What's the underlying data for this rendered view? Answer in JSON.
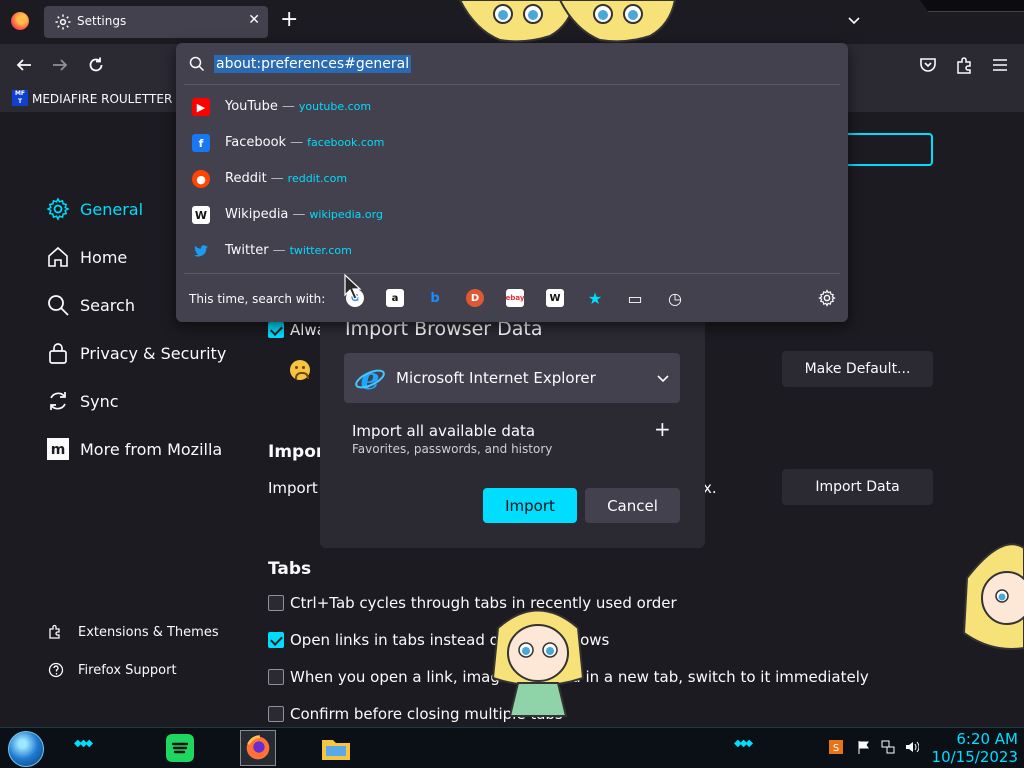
{
  "tab": {
    "title": "Settings",
    "close_glyph": "✕",
    "new_tab_glyph": "+"
  },
  "bookmarks": {
    "items": [
      {
        "label": "MEDIAFIRE ROULETTER",
        "icon_text": "MF T"
      }
    ]
  },
  "sidebar": {
    "categories": [
      {
        "label": "General",
        "icon": "gear-icon",
        "active": true
      },
      {
        "label": "Home",
        "icon": "home-icon"
      },
      {
        "label": "Search",
        "icon": "search-icon"
      },
      {
        "label": "Privacy & Security",
        "icon": "lock-icon"
      },
      {
        "label": "Sync",
        "icon": "sync-icon"
      },
      {
        "label": "More from Mozilla",
        "icon": "mozilla-icon"
      }
    ],
    "footer": [
      {
        "label": "Extensions & Themes",
        "icon": "puzzle-icon"
      },
      {
        "label": "Firefox Support",
        "icon": "help-icon"
      }
    ]
  },
  "general": {
    "always_check_partial": "Alwa",
    "make_default_label": "Make Default...",
    "import_heading_partial": "Import",
    "import_text_partial": "Import",
    "import_text_tail": "x.",
    "import_data_label": "Import Data",
    "tabs_heading": "Tabs",
    "tab_options": [
      {
        "label": "Ctrl+Tab cycles through tabs in recently used order",
        "checked": false
      },
      {
        "label": "Open links in tabs instead of new windows",
        "checked": true
      },
      {
        "label": "When you open a link, image or media in a new tab, switch to it immediately",
        "checked": false
      },
      {
        "label": "Confirm before closing multiple tabs",
        "checked": false
      }
    ]
  },
  "import_dialog": {
    "title": "Import Browser Data",
    "browser": "Microsoft Internet Explorer",
    "option_title": "Import all available data",
    "option_subtitle": "Favorites, passwords, and history",
    "plus_glyph": "+",
    "import_button": "Import",
    "cancel_button": "Cancel"
  },
  "url_panel": {
    "url": "about:preferences#general",
    "suggestions": [
      {
        "name": "YouTube",
        "site": "youtube.com",
        "icon_bg": "#ff0000",
        "icon_text": "▶"
      },
      {
        "name": "Facebook",
        "site": "facebook.com",
        "icon_bg": "#1877f2",
        "icon_text": "f"
      },
      {
        "name": "Reddit",
        "site": "reddit.com",
        "icon_bg": "#ff4500",
        "icon_text": "●"
      },
      {
        "name": "Wikipedia",
        "site": "wikipedia.org",
        "icon_bg": "#ffffff",
        "icon_text": "W"
      },
      {
        "name": "Twitter",
        "site": "twitter.com",
        "icon_bg": "#42414d",
        "icon_text": "🐦"
      }
    ],
    "separator": "—",
    "search_with_label": "This time, search with:",
    "engines": [
      {
        "name": "google-icon",
        "text": "G",
        "bg": "#ffffff",
        "fg": "#4285f4"
      },
      {
        "name": "amazon-icon",
        "text": "a",
        "bg": "#ffffff",
        "fg": "#111111"
      },
      {
        "name": "bing-icon",
        "text": "b",
        "bg": "#42414d",
        "fg": "#1a8cff"
      },
      {
        "name": "duckduckgo-icon",
        "text": "D",
        "bg": "#de5833",
        "fg": "#ffffff"
      },
      {
        "name": "ebay-icon",
        "text": "ebay",
        "bg": "#ffffff",
        "fg": "#e53238"
      },
      {
        "name": "wikipedia-icon",
        "text": "W",
        "bg": "#ffffff",
        "fg": "#111111"
      },
      {
        "name": "bookmarks-star-icon",
        "text": "★",
        "bg": "#42414d",
        "fg": "#00ddff"
      },
      {
        "name": "tabs-icon",
        "text": "▭",
        "bg": "#42414d",
        "fg": "#fbfbfe"
      },
      {
        "name": "history-icon",
        "text": "◷",
        "bg": "#42414d",
        "fg": "#fbfbfe"
      }
    ]
  },
  "taskbar": {
    "time": "6:20 AM",
    "date": "10/15/2023"
  },
  "colors": {
    "accent": "#00ddff",
    "panel": "#42414d",
    "page": "#1c1b22",
    "toolbar": "#2b2a33"
  }
}
